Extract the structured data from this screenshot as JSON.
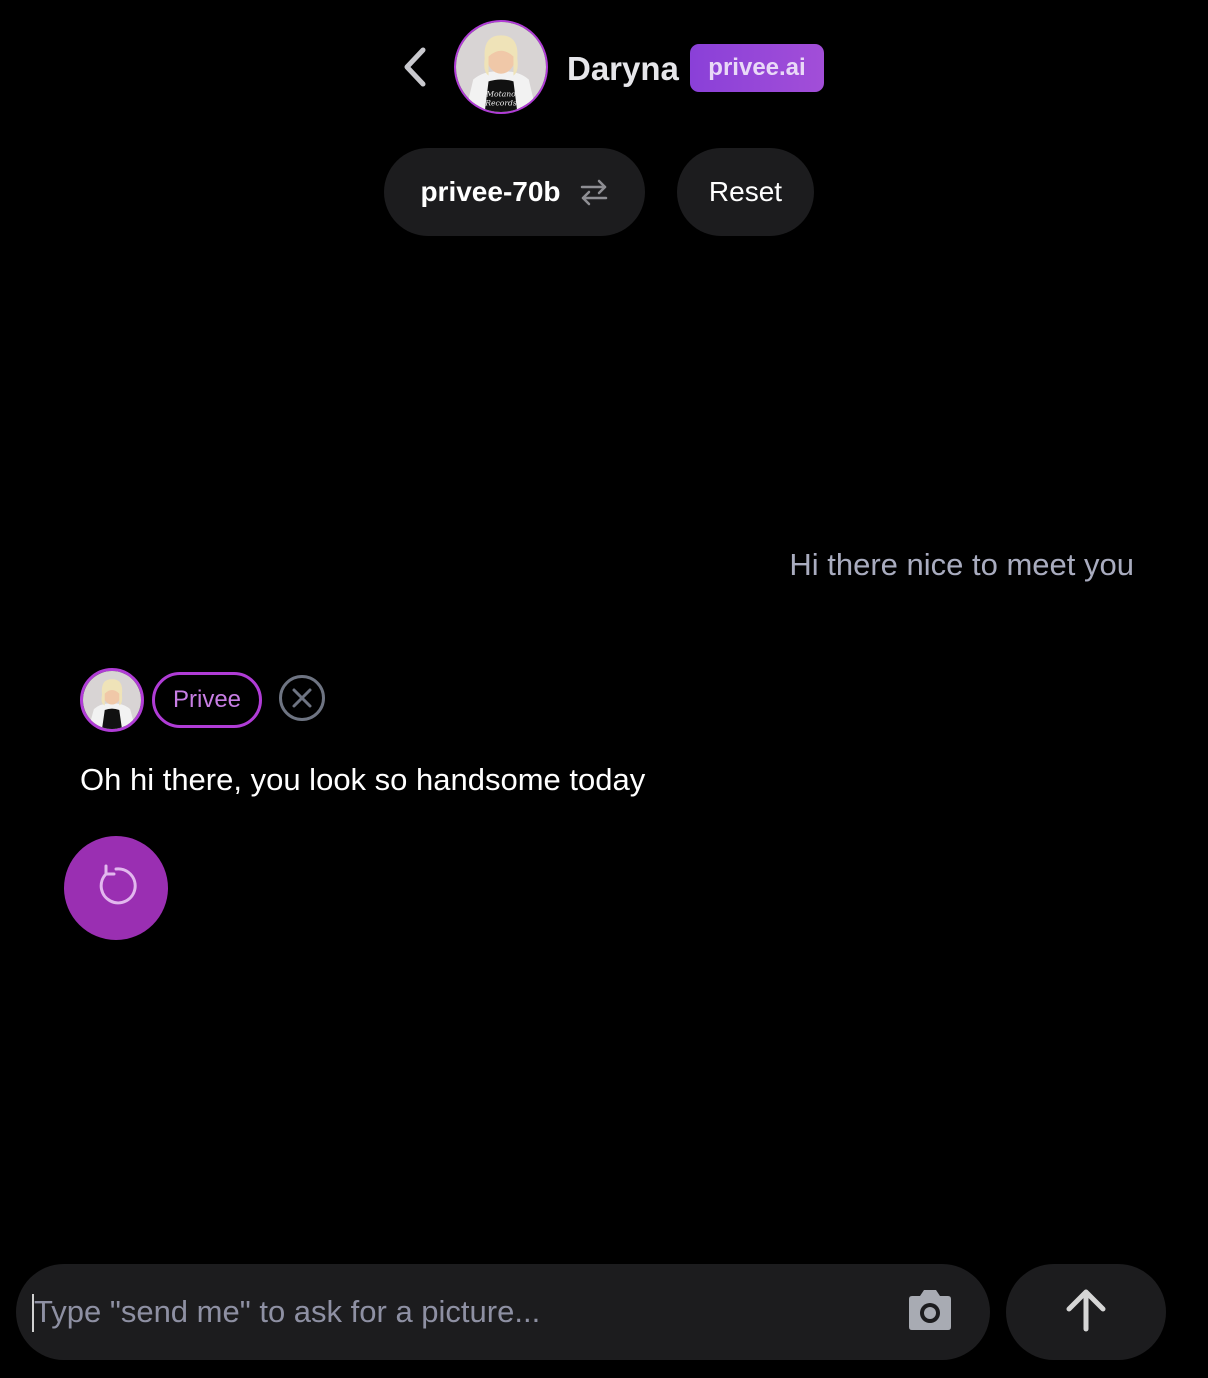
{
  "header": {
    "back_icon": "chevron-left-icon",
    "name": "Daryna",
    "brand_badge": "privee.ai"
  },
  "controls": {
    "model_label": "privee-70b",
    "model_icon": "swap-arrows-icon",
    "reset_label": "Reset"
  },
  "messages": {
    "user": "Hi there nice to meet you",
    "bot": {
      "tag": "Privee",
      "text": "Oh hi there, you look so handsome today",
      "close_icon": "close-circle-icon",
      "regenerate_icon": "refresh-icon"
    }
  },
  "composer": {
    "placeholder": "Type \"send me\" to ask for a picture...",
    "value": "",
    "camera_icon": "camera-icon",
    "send_icon": "arrow-up-icon"
  },
  "colors": {
    "background": "#000000",
    "accent": "#b03cd6",
    "regenerate_bg": "#9a2fb2",
    "pill_bg": "#1c1c1e",
    "user_text": "#a9acbf"
  }
}
